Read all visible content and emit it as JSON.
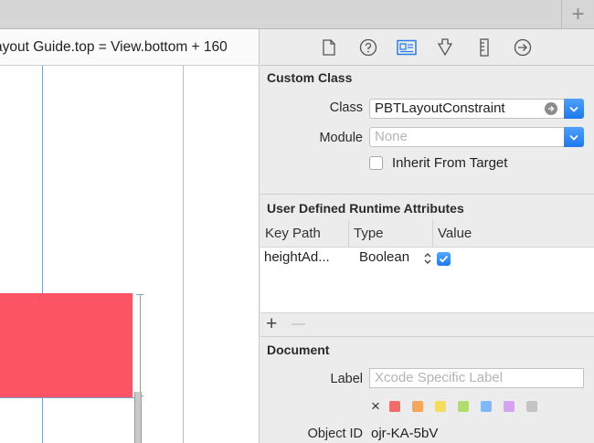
{
  "canvas": {
    "constraint_title": "ayout Guide.top = View.bottom + 160"
  },
  "toolbar": {
    "add_icon": "plus-icon"
  },
  "inspector": {
    "tabs": [
      {
        "icon": "file-icon",
        "active": false
      },
      {
        "icon": "help-icon",
        "active": false
      },
      {
        "icon": "identity-icon",
        "active": true
      },
      {
        "icon": "attributes-icon",
        "active": false
      },
      {
        "icon": "size-icon",
        "active": false
      },
      {
        "icon": "connections-icon",
        "active": false
      }
    ],
    "custom_class": {
      "header": "Custom Class",
      "class_label": "Class",
      "class_value": "PBTLayoutConstraint",
      "module_label": "Module",
      "module_placeholder": "None",
      "inherit_label": "Inherit From Target",
      "inherit_checked": false
    },
    "runtime_attributes": {
      "header": "User Defined Runtime Attributes",
      "columns": [
        "Key Path",
        "Type",
        "Value"
      ],
      "rows": [
        {
          "key_path": "heightAd...",
          "type": "Boolean",
          "value": true
        }
      ],
      "add_label": "+",
      "remove_label": "—"
    },
    "document": {
      "header": "Document",
      "label_label": "Label",
      "label_placeholder": "Xcode Specific Label",
      "clear_label": "×",
      "swatch_colors": [
        "#f26b6b",
        "#f6a55a",
        "#f5dc5e",
        "#b3dc6e",
        "#7fb8f7",
        "#d2a3ee",
        "#c4c4c4"
      ],
      "object_id_label": "Object ID",
      "object_id_value": "ojr-KA-5bV"
    }
  }
}
